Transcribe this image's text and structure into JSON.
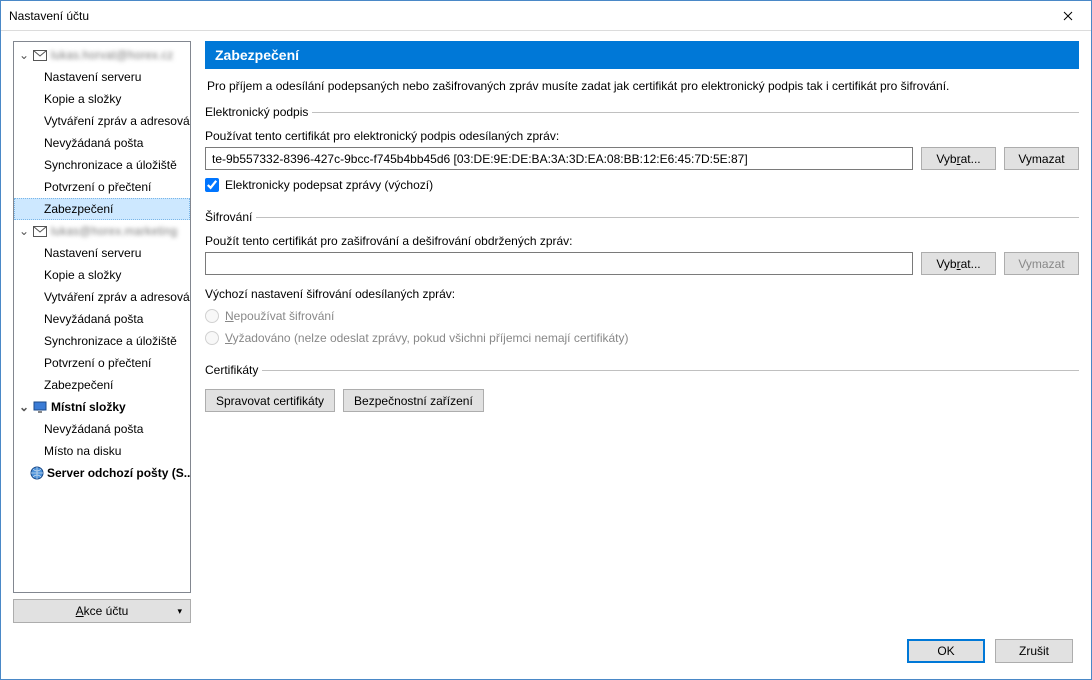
{
  "window": {
    "title": "Nastavení účtu"
  },
  "sidebar": {
    "accounts": [
      {
        "label": "lukas.horvat@horex.cz",
        "blurred": true,
        "icon": "mail-icon",
        "children": [
          "Nastavení serveru",
          "Kopie a složky",
          "Vytváření zpráv a adresování",
          "Nevyžádaná pošta",
          "Synchronizace a úložiště",
          "Potvrzení o přečtení",
          "Zabezpečení"
        ],
        "selected_index": 6
      },
      {
        "label": "lukas@horex.marketing",
        "blurred": true,
        "icon": "mail-icon",
        "children": [
          "Nastavení serveru",
          "Kopie a složky",
          "Vytváření zpráv a adresování",
          "Nevyžádaná pošta",
          "Synchronizace a úložiště",
          "Potvrzení o přečtení",
          "Zabezpečení"
        ],
        "selected_index": -1
      },
      {
        "label": "Místní složky",
        "blurred": false,
        "bold": true,
        "icon": "monitor-icon",
        "children": [
          "Nevyžádaná pošta",
          "Místo na disku"
        ],
        "selected_index": -1
      }
    ],
    "outgoing": {
      "label": "Server odchozí pošty (S...",
      "icon": "globe-icon"
    },
    "account_actions_label": "Akce účtu"
  },
  "panel": {
    "title": "Zabezpečení",
    "intro": "Pro příjem a odesílání podepsaných nebo zašifrovaných zpráv musíte zadat jak certifikát pro elektronický podpis tak i certifikát pro šifrování.",
    "signing": {
      "legend": "Elektronický podpis",
      "label": "Používat tento certifikát pro elektronický podpis odesílaných zpráv:",
      "value": "te-9b557332-8396-427c-9bcc-f745b4bb45d6 [03:DE:9E:DE:BA:3A:3D:EA:08:BB:12:E6:45:7D:5E:87]",
      "select_btn": "Vybrat...",
      "select_ul_char": "r",
      "clear_btn": "Vymazat",
      "checkbox_label": "Elektronicky podepsat zprávy (výchozí)",
      "checkbox_checked": true
    },
    "encryption": {
      "legend": "Šifrování",
      "label": "Použít tento certifikát pro zašifrování a dešifrování obdržených zpráv:",
      "value": "",
      "select_btn": "Vybrat...",
      "select_ul_char": "r",
      "clear_btn": "Vymazat",
      "clear_disabled": true,
      "default_label": "Výchozí nastavení šifrování odesílaných zpráv:",
      "radio_none": "Nepoužívat šifrování",
      "radio_required": "Vyžadováno (nelze odeslat zprávy, pokud všichni příjemci nemají certifikáty)",
      "radios_disabled": true
    },
    "certs": {
      "legend": "Certifikáty",
      "manage_btn": "Spravovat certifikáty",
      "devices_btn": "Bezpečnostní zařízení"
    }
  },
  "footer": {
    "ok": "OK",
    "cancel": "Zrušit"
  }
}
